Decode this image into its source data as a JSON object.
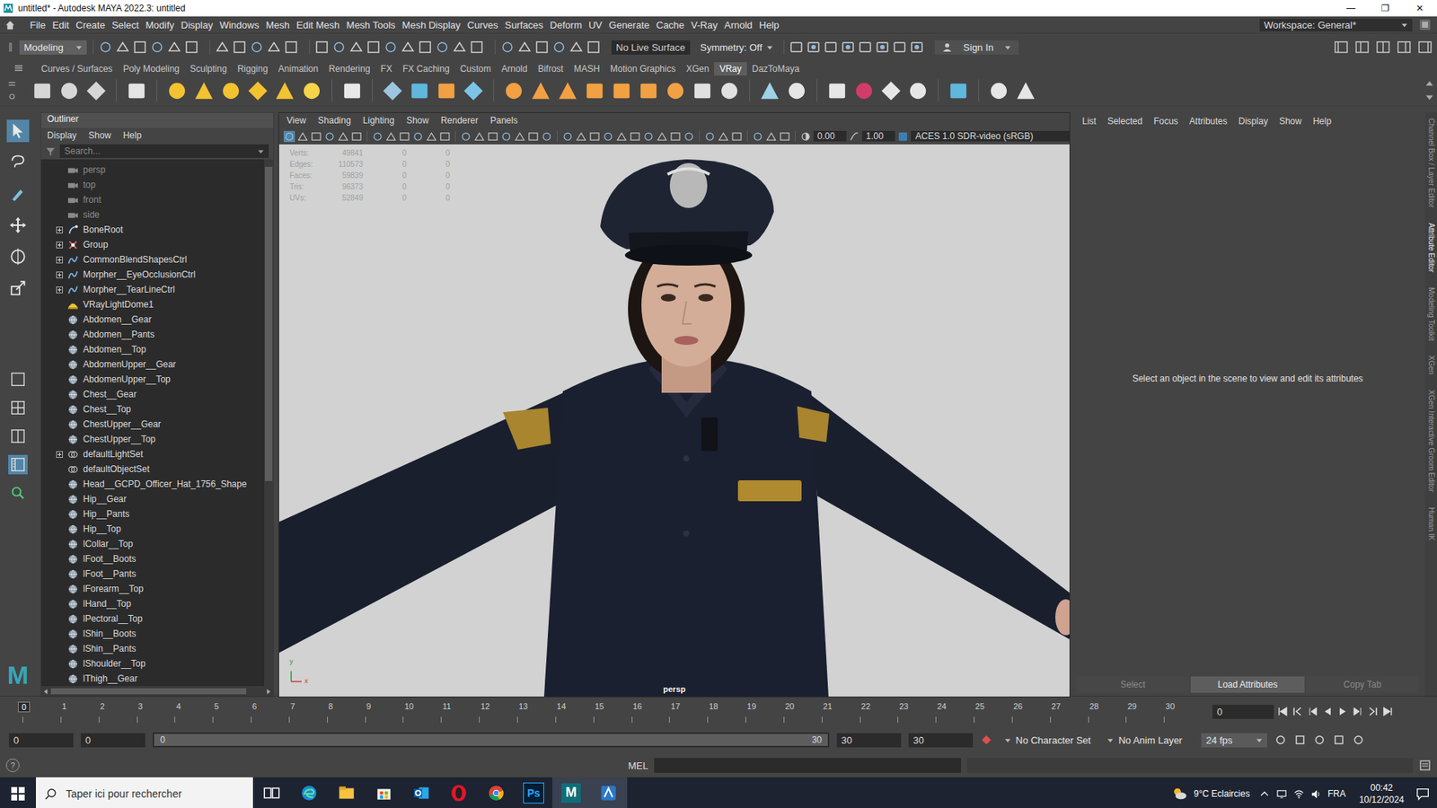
{
  "window": {
    "title": "untitled* - Autodesk MAYA 2022.3: untitled",
    "controls": [
      "—",
      "❐",
      "✕"
    ]
  },
  "menu_bar": {
    "items": [
      "File",
      "Edit",
      "Create",
      "Select",
      "Modify",
      "Display",
      "Windows",
      "Mesh",
      "Edit Mesh",
      "Mesh Tools",
      "Mesh Display",
      "Curves",
      "Surfaces",
      "Deform",
      "UV",
      "Generate",
      "Cache",
      "V-Ray",
      "Arnold",
      "Help"
    ],
    "workspace": "Workspace: General*"
  },
  "status_line": {
    "mode": "Modeling",
    "live_surface": "No Live Surface",
    "symmetry": "Symmetry: Off",
    "sign_in": "Sign In"
  },
  "shelf": {
    "tabs": [
      {
        "label": "Curves / Surfaces",
        "selected": false
      },
      {
        "label": "Poly Modeling",
        "selected": false
      },
      {
        "label": "Sculpting",
        "selected": false
      },
      {
        "label": "Rigging",
        "selected": false
      },
      {
        "label": "Animation",
        "selected": false
      },
      {
        "label": "Rendering",
        "selected": false
      },
      {
        "label": "FX",
        "selected": false
      },
      {
        "label": "FX Caching",
        "selected": false
      },
      {
        "label": "Custom",
        "selected": false
      },
      {
        "label": "Arnold",
        "selected": false
      },
      {
        "label": "Bifrost",
        "selected": false
      },
      {
        "label": "MASH",
        "selected": false
      },
      {
        "label": "Motion Graphics",
        "selected": false
      },
      {
        "label": "XGen",
        "selected": false
      },
      {
        "label": "VRay",
        "selected": true
      },
      {
        "label": "DazToMaya",
        "selected": false
      }
    ]
  },
  "toolbox": {
    "logo": "M"
  },
  "outliner": {
    "title": "Outliner",
    "menu": [
      "Display",
      "Show",
      "Help"
    ],
    "search_placeholder": "Search...",
    "items": [
      {
        "label": "persp",
        "kind": "camera",
        "expandable": false,
        "dimmed": true
      },
      {
        "label": "top",
        "kind": "camera",
        "expandable": false,
        "dimmed": true
      },
      {
        "label": "front",
        "kind": "camera",
        "expandable": false,
        "dimmed": true
      },
      {
        "label": "side",
        "kind": "camera",
        "expandable": false,
        "dimmed": true
      },
      {
        "label": "BoneRoot",
        "kind": "joint",
        "expandable": true,
        "dimmed": false
      },
      {
        "label": "Group",
        "kind": "group",
        "expandable": true,
        "dimmed": false
      },
      {
        "label": "CommonBlendShapesCtrl",
        "kind": "curve",
        "expandable": true,
        "dimmed": false
      },
      {
        "label": "Morpher__EyeOcclusionCtrl",
        "kind": "curve",
        "expandable": true,
        "dimmed": false
      },
      {
        "label": "Morpher__TearLineCtrl",
        "kind": "curve",
        "expandable": true,
        "dimmed": false
      },
      {
        "label": "VRayLightDome1",
        "kind": "light",
        "expandable": false,
        "dimmed": false
      },
      {
        "label": "Abdomen__Gear",
        "kind": "mesh",
        "expandable": false,
        "dimmed": false
      },
      {
        "label": "Abdomen__Pants",
        "kind": "mesh",
        "expandable": false,
        "dimmed": false
      },
      {
        "label": "Abdomen__Top",
        "kind": "mesh",
        "expandable": false,
        "dimmed": false
      },
      {
        "label": "AbdomenUpper__Gear",
        "kind": "mesh",
        "expandable": false,
        "dimmed": false
      },
      {
        "label": "AbdomenUpper__Top",
        "kind": "mesh",
        "expandable": false,
        "dimmed": false
      },
      {
        "label": "Chest__Gear",
        "kind": "mesh",
        "expandable": false,
        "dimmed": false
      },
      {
        "label": "Chest__Top",
        "kind": "mesh",
        "expandable": false,
        "dimmed": false
      },
      {
        "label": "ChestUpper__Gear",
        "kind": "mesh",
        "expandable": false,
        "dimmed": false
      },
      {
        "label": "ChestUpper__Top",
        "kind": "mesh",
        "expandable": false,
        "dimmed": false
      },
      {
        "label": "defaultLightSet",
        "kind": "set",
        "expandable": true,
        "dimmed": false
      },
      {
        "label": "defaultObjectSet",
        "kind": "set",
        "expandable": false,
        "dimmed": false
      },
      {
        "label": "Head__GCPD_Officer_Hat_1756_Shape",
        "kind": "mesh",
        "expandable": false,
        "dimmed": false
      },
      {
        "label": "Hip__Gear",
        "kind": "mesh",
        "expandable": false,
        "dimmed": false
      },
      {
        "label": "Hip__Pants",
        "kind": "mesh",
        "expandable": false,
        "dimmed": false
      },
      {
        "label": "Hip__Top",
        "kind": "mesh",
        "expandable": false,
        "dimmed": false
      },
      {
        "label": "lCollar__Top",
        "kind": "mesh",
        "expandable": false,
        "dimmed": false
      },
      {
        "label": "lFoot__Boots",
        "kind": "mesh",
        "expandable": false,
        "dimmed": false
      },
      {
        "label": "lFoot__Pants",
        "kind": "mesh",
        "expandable": false,
        "dimmed": false
      },
      {
        "label": "lForearm__Top",
        "kind": "mesh",
        "expandable": false,
        "dimmed": false
      },
      {
        "label": "lHand__Top",
        "kind": "mesh",
        "expandable": false,
        "dimmed": false
      },
      {
        "label": "lPectoral__Top",
        "kind": "mesh",
        "expandable": false,
        "dimmed": false
      },
      {
        "label": "lShin__Boots",
        "kind": "mesh",
        "expandable": false,
        "dimmed": false
      },
      {
        "label": "lShin__Pants",
        "kind": "mesh",
        "expandable": false,
        "dimmed": false
      },
      {
        "label": "lShoulder__Top",
        "kind": "mesh",
        "expandable": false,
        "dimmed": false
      },
      {
        "label": "lThigh__Gear",
        "kind": "mesh",
        "expandable": false,
        "dimmed": false
      }
    ]
  },
  "viewport": {
    "menu": [
      "View",
      "Shading",
      "Lighting",
      "Show",
      "Renderer",
      "Panels"
    ],
    "exposure": "0.00",
    "gamma": "1.00",
    "color_space": "ACES 1.0 SDR-video (sRGB)",
    "stats": [
      {
        "label": "Verts:",
        "values": [
          "49841",
          "0",
          "0"
        ]
      },
      {
        "label": "Edges:",
        "values": [
          "110573",
          "0",
          "0"
        ]
      },
      {
        "label": "Faces:",
        "values": [
          "59839",
          "0",
          "0"
        ]
      },
      {
        "label": "Tris:",
        "values": [
          "96373",
          "0",
          "0"
        ]
      },
      {
        "label": "UVs:",
        "values": [
          "52849",
          "0",
          "0"
        ]
      }
    ],
    "camera": "persp",
    "axis": [
      "y",
      "x"
    ]
  },
  "attribute_editor": {
    "menu": [
      "List",
      "Selected",
      "Focus",
      "Attributes",
      "Display",
      "Show",
      "Help"
    ],
    "message": "Select an object in the scene to view and edit its attributes",
    "buttons": [
      {
        "label": "Select",
        "disabled": true
      },
      {
        "label": "Load Attributes",
        "disabled": false
      },
      {
        "label": "Copy Tab",
        "disabled": true
      }
    ]
  },
  "side_tabs": [
    {
      "label": "Channel Box / Layer Editor",
      "selected": false
    },
    {
      "label": "Attribute Editor",
      "selected": true
    },
    {
      "label": "Modeling Toolkit",
      "selected": false
    },
    {
      "label": "XGen",
      "selected": false
    },
    {
      "label": "XGen Interactive Groom Editor",
      "selected": false
    },
    {
      "label": "Human IK",
      "selected": false
    }
  ],
  "time_slider": {
    "ticks": [
      {
        "label": "0",
        "current": true
      },
      {
        "label": "1",
        "current": false
      },
      {
        "label": "2",
        "current": false
      },
      {
        "label": "3",
        "current": false
      },
      {
        "label": "4",
        "current": false
      },
      {
        "label": "5",
        "current": false
      },
      {
        "label": "6",
        "current": false
      },
      {
        "label": "7",
        "current": false
      },
      {
        "label": "8",
        "current": false
      },
      {
        "label": "9",
        "current": false
      },
      {
        "label": "10",
        "current": false
      },
      {
        "label": "11",
        "current": false
      },
      {
        "label": "12",
        "current": false
      },
      {
        "label": "13",
        "current": false
      },
      {
        "label": "14",
        "current": false
      },
      {
        "label": "15",
        "current": false
      },
      {
        "label": "16",
        "current": false
      },
      {
        "label": "17",
        "current": false
      },
      {
        "label": "18",
        "current": false
      },
      {
        "label": "19",
        "current": false
      },
      {
        "label": "20",
        "current": false
      },
      {
        "label": "21",
        "current": false
      },
      {
        "label": "22",
        "current": false
      },
      {
        "label": "23",
        "current": false
      },
      {
        "label": "24",
        "current": false
      },
      {
        "label": "25",
        "current": false
      },
      {
        "label": "26",
        "current": false
      },
      {
        "label": "27",
        "current": false
      },
      {
        "label": "28",
        "current": false
      },
      {
        "label": "29",
        "current": false
      },
      {
        "label": "30",
        "current": false
      }
    ],
    "current_frame": "0"
  },
  "range_slider": {
    "start": "0",
    "playback_start": "0",
    "bar_start": "0",
    "bar_end": "30",
    "playback_end": "30",
    "end": "30",
    "character_set": "No Character Set",
    "anim_layer": "No Anim Layer",
    "fps": "24 fps"
  },
  "command_line": {
    "help": "?",
    "language": "MEL"
  },
  "taskbar": {
    "search_placeholder": "Taper ici pour rechercher",
    "apps": [
      {
        "kind": "task-view",
        "selected": false
      },
      {
        "kind": "edge",
        "selected": false
      },
      {
        "kind": "explorer",
        "selected": false
      },
      {
        "kind": "store",
        "selected": false
      },
      {
        "kind": "outlook",
        "selected": false
      },
      {
        "kind": "opera",
        "selected": false
      },
      {
        "kind": "chrome",
        "selected": false
      },
      {
        "kind": "photoshop",
        "label": "Ps",
        "selected": false
      },
      {
        "kind": "maya",
        "label": "M",
        "selected": true
      },
      {
        "kind": "daz",
        "selected": true
      }
    ],
    "weather": "9°C  Eclaircies",
    "language": "FRA",
    "time": "00:42",
    "date": "10/12/2024"
  }
}
